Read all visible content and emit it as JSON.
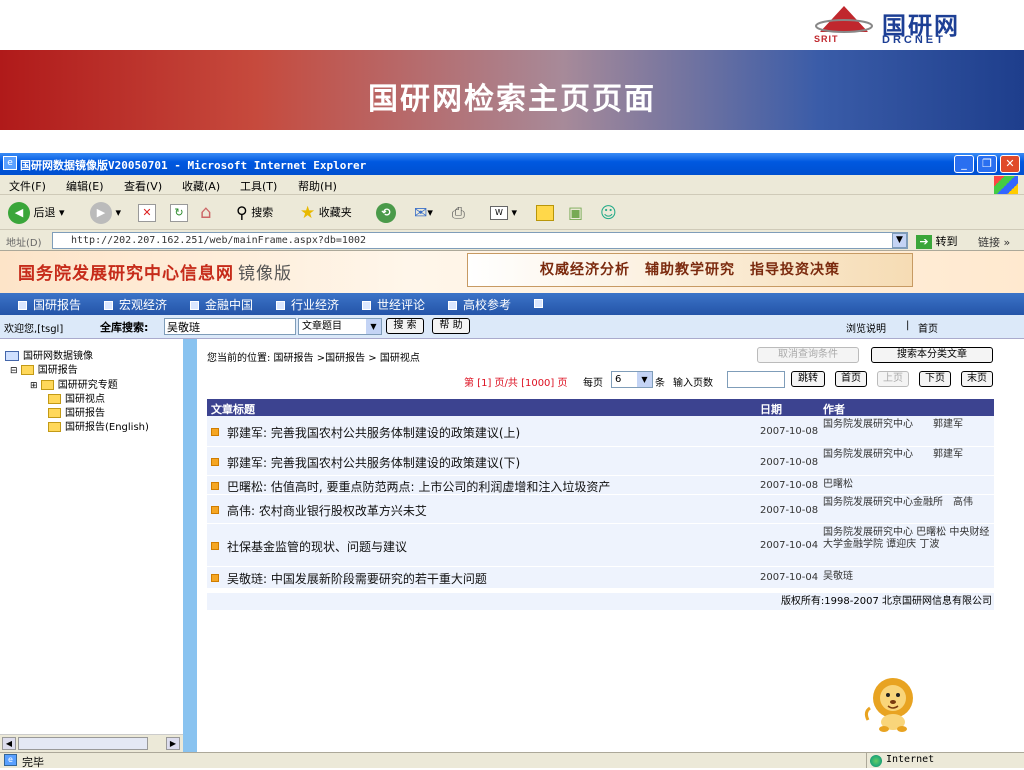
{
  "slide": {
    "logo_main": "国研网",
    "logo_srit": "SRIT",
    "logo_drcnet": "DRCNET",
    "title": "国研网检索主页页面"
  },
  "window": {
    "title": "国研网数据镜像版V20050701 - Microsoft Internet Explorer",
    "controls": [
      "_",
      "❐",
      "✕"
    ]
  },
  "menu": [
    "文件(F)",
    "编辑(E)",
    "查看(V)",
    "收藏(A)",
    "工具(T)",
    "帮助(H)"
  ],
  "toolbar": {
    "back": "后退",
    "search": "搜索",
    "favorites": "收藏夹"
  },
  "address": {
    "label": "地址(D)",
    "url": "http://202.207.162.251/web/mainFrame.aspx?db=1002",
    "go": "转到",
    "links": "链接"
  },
  "site": {
    "title": "国务院发展研究中心信息网",
    "mirror": "镜像版",
    "slogan": "权威经济分析　辅助教学研究　指导投资决策"
  },
  "nav": [
    "国研报告",
    "宏观经济",
    "金融中国",
    "行业经济",
    "世经评论",
    "高校参考"
  ],
  "searchbar": {
    "welcome": "欢迎您,[tsgl]",
    "label": "全库搜索:",
    "keyword": "吴敬琏",
    "field_option": "文章题目",
    "search_btn": "搜 索",
    "help_btn": "帮 助",
    "browse_help": "浏览说明",
    "sep": "|",
    "home": "首页"
  },
  "tree": {
    "root": "国研网数据镜像",
    "items": [
      "国研报告",
      "国研研究专题",
      "国研视点",
      "国研报告",
      "国研报告(English)"
    ]
  },
  "main": {
    "breadcrumb": "您当前的位置: 国研报告 >国研报告 > 国研视点",
    "cancel_btn": "取消查询条件",
    "search_unclassified_btn": "搜索本分类文章",
    "pager": {
      "info": "第 [1] 页/共 [1000] 页",
      "per_page_label": "每页",
      "per_page": "6",
      "per_page_unit": "条",
      "input_label": "输入页数",
      "jump": "跳转",
      "first": "首页",
      "prev": "上页",
      "next": "下页",
      "last": "末页"
    },
    "columns": [
      "文章标题",
      "日期",
      "作者"
    ],
    "rows": [
      {
        "title": "郭建军: 完善我国农村公共服务体制建设的政策建议(上)",
        "date": "2007-10-08",
        "author": "国务院发展研究中心　　郭建军"
      },
      {
        "title": "郭建军: 完善我国农村公共服务体制建设的政策建议(下)",
        "date": "2007-10-08",
        "author": "国务院发展研究中心　　郭建军"
      },
      {
        "title": "巴曙松: 估值高时, 要重点防范两点: 上市公司的利润虚增和注入垃圾资产",
        "date": "2007-10-08",
        "author": "巴曙松"
      },
      {
        "title": "高伟: 农村商业银行股权改革方兴未艾",
        "date": "2007-10-08",
        "author": "国务院发展研究中心金融所　高伟"
      },
      {
        "title": "社保基金监管的现状、问题与建议",
        "date": "2007-10-04",
        "author": "国务院发展研究中心 巴曙松 中央财经大学金融学院 谭迎庆 丁波"
      },
      {
        "title": "吴敬琏: 中国发展新阶段需要研究的若干重大问题",
        "date": "2007-10-04",
        "author": "吴敬琏"
      }
    ],
    "copyright": "版权所有:1998-2007 北京国研网信息有限公司"
  },
  "status": {
    "left": "完毕",
    "zone": "Internet"
  }
}
